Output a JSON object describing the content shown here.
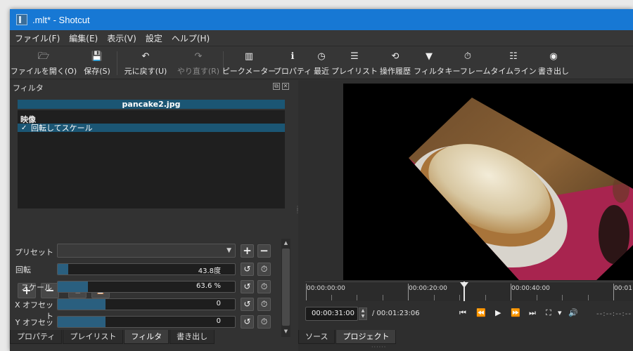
{
  "window": {
    "title": ".mlt* - Shotcut"
  },
  "menu": [
    "ファイル(F)",
    "編集(E)",
    "表示(V)",
    "設定",
    "ヘルプ(H)"
  ],
  "toolbar": [
    {
      "label": "ファイルを開く(O)",
      "icon": "folder-icon",
      "glyph": "🗁"
    },
    {
      "label": "保存(S)",
      "icon": "save-icon",
      "glyph": "💾"
    },
    {
      "label": "元に戻す(U)",
      "icon": "undo-icon",
      "glyph": "↶"
    },
    {
      "label": "やり直す(R)",
      "icon": "redo-icon",
      "glyph": "↷"
    },
    {
      "label": "ピークメーター",
      "icon": "peak-meter-icon",
      "glyph": "▥"
    },
    {
      "label": "プロパティ",
      "icon": "info-icon",
      "glyph": "ℹ"
    },
    {
      "label": "最近",
      "icon": "clock-icon",
      "glyph": "◷"
    },
    {
      "label": "プレイリスト",
      "icon": "list-icon",
      "glyph": "☰"
    },
    {
      "label": "操作履歴",
      "icon": "history-icon",
      "glyph": "⟲"
    },
    {
      "label": "フィルタ",
      "icon": "filter-icon",
      "glyph": "▼"
    },
    {
      "label": "キーフレーム",
      "icon": "stopwatch-icon",
      "glyph": "⏱"
    },
    {
      "label": "タイムライン",
      "icon": "timeline-icon",
      "glyph": "☷"
    },
    {
      "label": "書き出し",
      "icon": "export-icon",
      "glyph": "◉"
    }
  ],
  "filter_panel": {
    "title": "フィルタ",
    "clip_name": "pancake2.jpg",
    "category": "映像",
    "filter_item": {
      "check": "✓",
      "name": "回転してスケール"
    },
    "buttons": {
      "add": "+",
      "remove": "−",
      "copy": "⧉",
      "paste": "📋"
    },
    "preset_label": "プリセット",
    "params": [
      {
        "label": "回転",
        "value": "43.8度",
        "fraction": 0.06
      },
      {
        "label": "スケール",
        "value": "63.6 %",
        "fraction": 0.17
      },
      {
        "label": "X オフセット",
        "value": "0",
        "fraction": 0.27
      },
      {
        "label": "Y オフセット",
        "value": "0",
        "fraction": 0.27
      }
    ],
    "reset_glyph": "↺",
    "keyframe_glyph": "⏱"
  },
  "left_tabs": [
    "プロパティ",
    "プレイリスト",
    "フィルタ",
    "書き出し"
  ],
  "player": {
    "ruler": [
      "00:00:00:00",
      "00:00:20:00",
      "00:00:40:00",
      "00:01"
    ],
    "timecode": "00:00:31:00",
    "duration": "/ 00:01:23:06",
    "remaining": "--:--:--:--",
    "transport": {
      "skip_prev": "⏮",
      "rewind": "⏪",
      "play": "▶",
      "fast_forward": "⏩",
      "skip_next": "⏭",
      "zoom": "⛶",
      "zoom_arrow": "▾",
      "volume": "🔊"
    }
  },
  "right_tabs": [
    "ソース",
    "プロジェクト"
  ],
  "colors": {
    "titlebar": "#1778d4",
    "selection": "#1b5674",
    "slider_fill": "#2a5f7f"
  }
}
